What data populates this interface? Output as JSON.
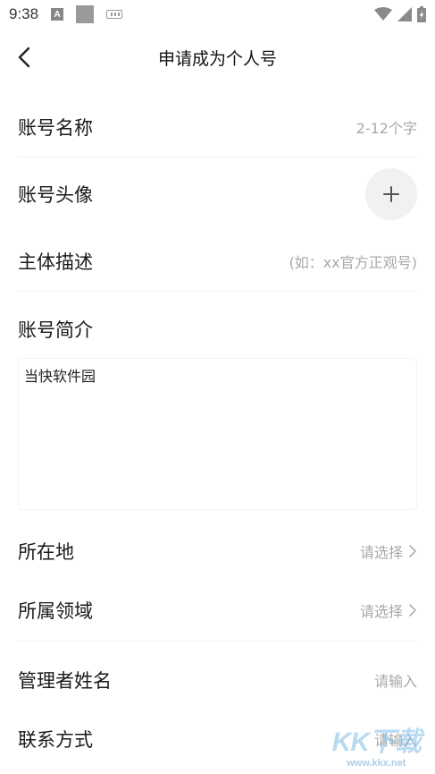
{
  "status_bar": {
    "time": "9:38",
    "notification_letter": "A"
  },
  "header": {
    "title": "申请成为个人号"
  },
  "form": {
    "account_name": {
      "label": "账号名称",
      "placeholder": "2-12个字"
    },
    "account_avatar": {
      "label": "账号头像"
    },
    "entity_description": {
      "label": "主体描述",
      "placeholder": "(如：xx官方正观号)"
    },
    "account_bio": {
      "label": "账号简介",
      "value": "当快软件园"
    },
    "location": {
      "label": "所在地",
      "value": "请选择"
    },
    "domain": {
      "label": "所属领域",
      "value": "请选择"
    },
    "admin_name": {
      "label": "管理者姓名",
      "placeholder": "请输入"
    },
    "contact": {
      "label": "联系方式",
      "placeholder": "请输入"
    }
  },
  "watermark": {
    "logo": "KK下载",
    "url": "www.kkx.net"
  },
  "colors": {
    "text": "#1a1a1a",
    "placeholder": "#a8a8a8",
    "divider": "#f2f2f2",
    "avatar_bg": "#f1f1f1"
  }
}
